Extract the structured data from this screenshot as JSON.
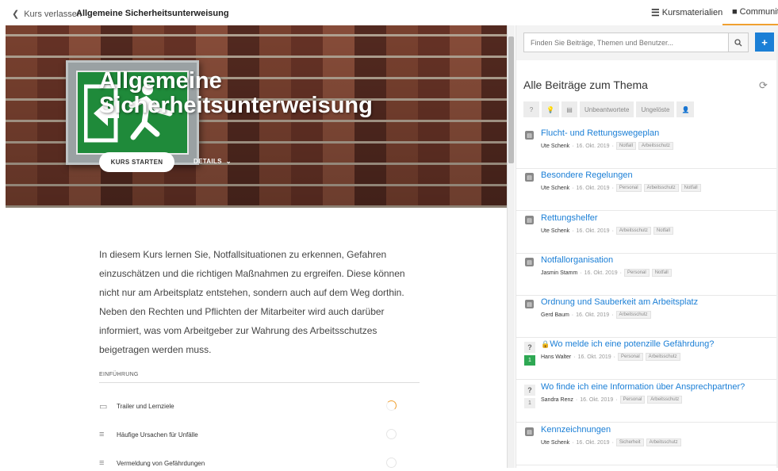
{
  "topbar": {
    "back_label": "Kurs verlassen",
    "course_title": "Allgemeine Sicherheitsunterweisung",
    "tab_materials": "Kursmaterialien",
    "tab_community": "Community"
  },
  "hero": {
    "title": "Allgemeine Sicherheitsunterweisung",
    "start_button": "KURS STARTEN",
    "details_label": "DETAILS"
  },
  "description": "In diesem Kurs lernen Sie, Notfallsituationen zu erkennen, Gefahren einzuschätzen und die richtigen Maßnahmen zu ergreifen. Diese können nicht nur am Arbeitsplatz entstehen, sondern auch auf dem Weg dorthin. Neben den Rechten und Pflichten der Mitarbeiter wird auch darüber informiert, was vom Arbeitgeber zur Wahrung des Arbeitsschutzes beigetragen werden muss.",
  "section": {
    "label": "EINFÜHRUNG",
    "lessons": [
      {
        "title": "Trailer und Lernziele",
        "icon": "video-icon",
        "in_progress": true
      },
      {
        "title": "Häufige Ursachen für Unfälle",
        "icon": "text-lines-icon",
        "in_progress": false
      },
      {
        "title": "Vermeldung von Gefährdungen",
        "icon": "text-lines-icon",
        "in_progress": false
      }
    ]
  },
  "community": {
    "search_placeholder": "Finden Sie Beiträge, Themen und Benutzer...",
    "add_label": "+",
    "thread_title": "Alle Beiträge zum Thema",
    "filters": {
      "question": "?",
      "idea": "💡",
      "note": "▤",
      "unanswered": "Unbeantwortete",
      "unresolved": "Ungelöste",
      "user": "👤"
    },
    "posts": [
      {
        "title": "Flucht- und Rettungswegeplan",
        "author": "Ute Schenk",
        "date": "16. Okt. 2019",
        "tags": [
          "Notfall",
          "Arbeitsschutz"
        ],
        "type": "note"
      },
      {
        "title": "Besondere Regelungen",
        "author": "Ute Schenk",
        "date": "16. Okt. 2019",
        "tags": [
          "Personal",
          "Arbeitsschutz",
          "Notfall"
        ],
        "type": "note"
      },
      {
        "title": "Rettungshelfer",
        "author": "Ute Schenk",
        "date": "16. Okt. 2019",
        "tags": [
          "Arbeitsschutz",
          "Notfall"
        ],
        "type": "note"
      },
      {
        "title": "Notfallorganisation",
        "author": "Jasmin Stamm",
        "date": "16. Okt. 2019",
        "tags": [
          "Personal",
          "Notfall"
        ],
        "type": "note"
      },
      {
        "title": "Ordnung und Sauberkeit am Arbeitsplatz",
        "author": "Gerd Baum",
        "date": "16. Okt. 2019",
        "tags": [
          "Arbeitsschutz"
        ],
        "type": "note"
      },
      {
        "title": "Wo melde ich eine potenzille Gefährdung?",
        "author": "Hans Walter",
        "date": "16. Okt. 2019",
        "tags": [
          "Personal",
          "Arbeitsschutz"
        ],
        "type": "question",
        "votes": "1",
        "locked": true
      },
      {
        "title": "Wo finde ich eine Information über Ansprechpartner?",
        "author": "Sandra Renz",
        "date": "16. Okt. 2019",
        "tags": [
          "Personal",
          "Arbeitsschutz"
        ],
        "type": "question",
        "votes": "1"
      },
      {
        "title": "Kennzeichnungen",
        "author": "Ute Schenk",
        "date": "16. Okt. 2019",
        "tags": [
          "Sicherheit",
          "Arbeitsschutz"
        ],
        "type": "note"
      }
    ]
  },
  "colors": {
    "accent": "#1b7fd6",
    "highlight": "#f0a030",
    "vote_green": "#2ea853"
  }
}
